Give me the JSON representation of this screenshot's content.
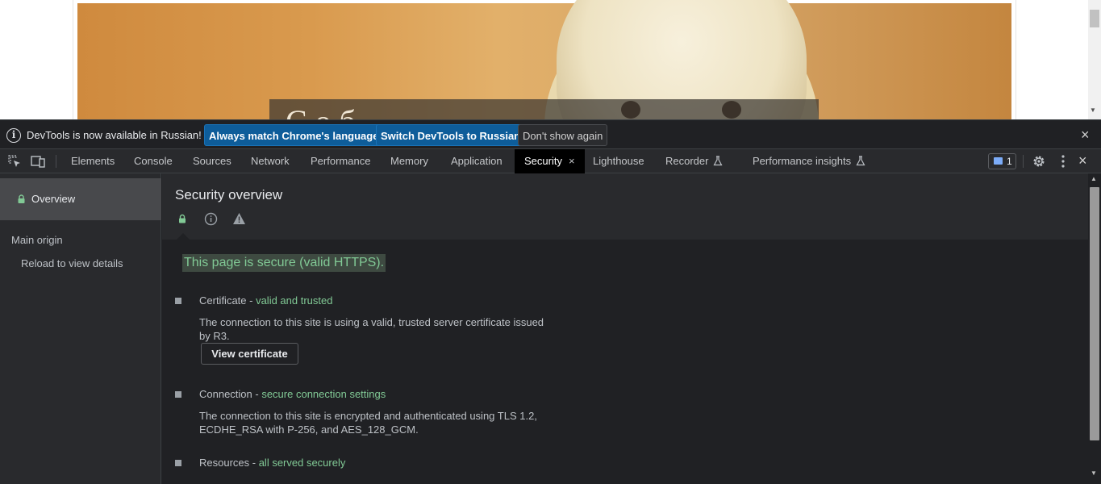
{
  "page": {
    "hero_caption": "C о б"
  },
  "infobar": {
    "text": "DevTools is now available in Russian!",
    "match_button": "Always match Chrome's language",
    "switch_button": "Switch DevTools to Russian",
    "dont_show_button": "Don't show again",
    "close_icon": "×"
  },
  "tabs": [
    {
      "label": "Elements",
      "active": false
    },
    {
      "label": "Console",
      "active": false
    },
    {
      "label": "Sources",
      "active": false
    },
    {
      "label": "Network",
      "active": false
    },
    {
      "label": "Performance",
      "active": false
    },
    {
      "label": "Memory",
      "active": false
    },
    {
      "label": "Application",
      "active": false
    },
    {
      "label": "Security",
      "active": true
    },
    {
      "label": "Lighthouse",
      "active": false
    },
    {
      "label": "Recorder",
      "active": false,
      "experimental": true
    },
    {
      "label": "Performance insights",
      "active": false,
      "experimental": true
    }
  ],
  "toolbar": {
    "issues_count": "1",
    "close_icon": "×",
    "tab_close_icon": "×"
  },
  "sidebar": {
    "overview": "Overview",
    "main_origin": "Main origin",
    "reload": "Reload to view details"
  },
  "main": {
    "title": "Security overview",
    "summary": "This page is secure (valid HTTPS).",
    "certificate": {
      "label": "Certificate - ",
      "status": "valid and trusted",
      "description": "The connection to this site is using a valid, trusted server certificate issued by R3.",
      "button": "View certificate"
    },
    "connection": {
      "label": "Connection - ",
      "status": "secure connection settings",
      "description": "The connection to this site is encrypted and authenticated using TLS 1.2, ECDHE_RSA with P-256, and AES_128_GCM."
    },
    "resources": {
      "label": "Resources - ",
      "status": "all served securely"
    }
  },
  "colors": {
    "secure_green": "#81c995",
    "primary_button": "#0e5d9a",
    "background": "#202124"
  }
}
